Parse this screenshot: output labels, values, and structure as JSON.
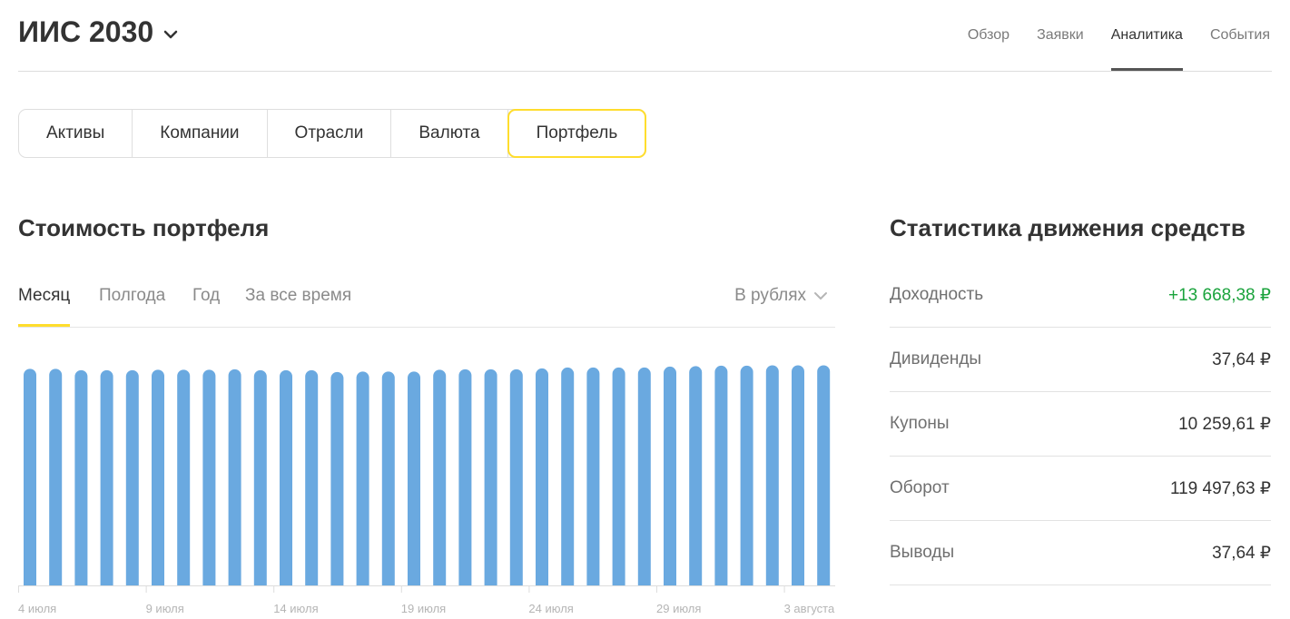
{
  "header": {
    "account": "ИИС 2030",
    "nav": [
      {
        "label": "Обзор",
        "active": false
      },
      {
        "label": "Заявки",
        "active": false
      },
      {
        "label": "Аналитика",
        "active": true
      },
      {
        "label": "События",
        "active": false
      }
    ]
  },
  "tabs": [
    {
      "label": "Активы",
      "active": false
    },
    {
      "label": "Компании",
      "active": false
    },
    {
      "label": "Отрасли",
      "active": false
    },
    {
      "label": "Валюта",
      "active": false
    },
    {
      "label": "Портфель",
      "active": true
    }
  ],
  "portfolio": {
    "title": "Стоимость портфеля",
    "periods": [
      {
        "label": "Месяц",
        "active": true
      },
      {
        "label": "Полгода",
        "active": false
      },
      {
        "label": "Год",
        "active": false
      },
      {
        "label": "За все время",
        "active": false
      }
    ],
    "currency": "В рублях"
  },
  "stats": {
    "title": "Статистика движения средств",
    "rows": [
      {
        "label": "Доходность",
        "value": "+13 668,38 ₽",
        "positive": true
      },
      {
        "label": "Дивиденды",
        "value": "37,64 ₽",
        "positive": false
      },
      {
        "label": "Купоны",
        "value": "10 259,61 ₽",
        "positive": false
      },
      {
        "label": "Оборот",
        "value": "119 497,63 ₽",
        "positive": false
      },
      {
        "label": "Выводы",
        "value": "37,64 ₽",
        "positive": false
      }
    ]
  },
  "colors": {
    "accent": "#ffdd2d",
    "bar": "#6aa9e0",
    "positive": "#1aa33c"
  },
  "chart_data": {
    "type": "bar",
    "categories": [
      "4 июля",
      "5 июля",
      "6 июля",
      "7 июля",
      "8 июля",
      "9 июля",
      "10 июля",
      "11 июля",
      "12 июля",
      "13 июля",
      "14 июля",
      "15 июля",
      "16 июля",
      "17 июля",
      "18 июля",
      "19 июля",
      "20 июля",
      "21 июля",
      "22 июля",
      "23 июля",
      "24 июля",
      "25 июля",
      "26 июля",
      "27 июля",
      "28 июля",
      "29 июля",
      "30 июля",
      "31 июля",
      "1 августа",
      "2 августа",
      "3 августа",
      "4 августа"
    ],
    "values": [
      97.0,
      97.0,
      96.4,
      96.4,
      96.4,
      96.6,
      96.6,
      96.6,
      96.8,
      96.4,
      96.4,
      96.4,
      95.6,
      95.8,
      95.8,
      95.8,
      96.6,
      96.8,
      96.8,
      96.8,
      97.2,
      97.6,
      97.6,
      97.6,
      97.6,
      98.0,
      98.2,
      98.4,
      98.4,
      98.6,
      98.6,
      98.6
    ],
    "tick_labels": [
      "4 июля",
      "9 июля",
      "14 июля",
      "19 июля",
      "24 июля",
      "29 июля",
      "3 августа"
    ],
    "ylim": [
      0,
      100
    ],
    "grid": false
  }
}
